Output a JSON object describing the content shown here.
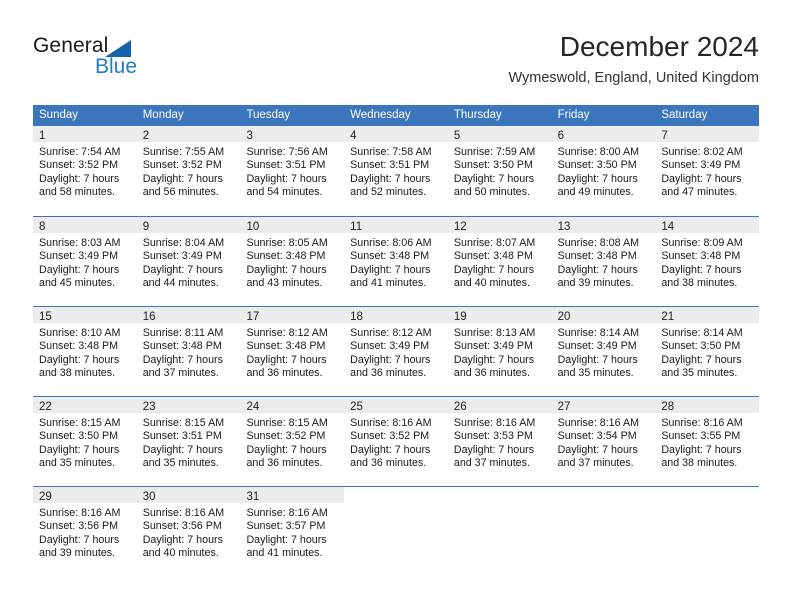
{
  "brand": {
    "name_part1": "General",
    "name_part2": "Blue"
  },
  "header": {
    "title": "December 2024",
    "location": "Wymeswold, England, United Kingdom"
  },
  "colors": {
    "header_blue": "#3b76bd",
    "daynum_band": "#ececec",
    "brand_blue": "#1d7dc4",
    "triangle_blue": "#1663ac"
  },
  "weekdays": [
    "Sunday",
    "Monday",
    "Tuesday",
    "Wednesday",
    "Thursday",
    "Friday",
    "Saturday"
  ],
  "weeks": [
    [
      {
        "day": "1",
        "sunrise": "Sunrise: 7:54 AM",
        "sunset": "Sunset: 3:52 PM",
        "daylight1": "Daylight: 7 hours",
        "daylight2": "and 58 minutes."
      },
      {
        "day": "2",
        "sunrise": "Sunrise: 7:55 AM",
        "sunset": "Sunset: 3:52 PM",
        "daylight1": "Daylight: 7 hours",
        "daylight2": "and 56 minutes."
      },
      {
        "day": "3",
        "sunrise": "Sunrise: 7:56 AM",
        "sunset": "Sunset: 3:51 PM",
        "daylight1": "Daylight: 7 hours",
        "daylight2": "and 54 minutes."
      },
      {
        "day": "4",
        "sunrise": "Sunrise: 7:58 AM",
        "sunset": "Sunset: 3:51 PM",
        "daylight1": "Daylight: 7 hours",
        "daylight2": "and 52 minutes."
      },
      {
        "day": "5",
        "sunrise": "Sunrise: 7:59 AM",
        "sunset": "Sunset: 3:50 PM",
        "daylight1": "Daylight: 7 hours",
        "daylight2": "and 50 minutes."
      },
      {
        "day": "6",
        "sunrise": "Sunrise: 8:00 AM",
        "sunset": "Sunset: 3:50 PM",
        "daylight1": "Daylight: 7 hours",
        "daylight2": "and 49 minutes."
      },
      {
        "day": "7",
        "sunrise": "Sunrise: 8:02 AM",
        "sunset": "Sunset: 3:49 PM",
        "daylight1": "Daylight: 7 hours",
        "daylight2": "and 47 minutes."
      }
    ],
    [
      {
        "day": "8",
        "sunrise": "Sunrise: 8:03 AM",
        "sunset": "Sunset: 3:49 PM",
        "daylight1": "Daylight: 7 hours",
        "daylight2": "and 45 minutes."
      },
      {
        "day": "9",
        "sunrise": "Sunrise: 8:04 AM",
        "sunset": "Sunset: 3:49 PM",
        "daylight1": "Daylight: 7 hours",
        "daylight2": "and 44 minutes."
      },
      {
        "day": "10",
        "sunrise": "Sunrise: 8:05 AM",
        "sunset": "Sunset: 3:48 PM",
        "daylight1": "Daylight: 7 hours",
        "daylight2": "and 43 minutes."
      },
      {
        "day": "11",
        "sunrise": "Sunrise: 8:06 AM",
        "sunset": "Sunset: 3:48 PM",
        "daylight1": "Daylight: 7 hours",
        "daylight2": "and 41 minutes."
      },
      {
        "day": "12",
        "sunrise": "Sunrise: 8:07 AM",
        "sunset": "Sunset: 3:48 PM",
        "daylight1": "Daylight: 7 hours",
        "daylight2": "and 40 minutes."
      },
      {
        "day": "13",
        "sunrise": "Sunrise: 8:08 AM",
        "sunset": "Sunset: 3:48 PM",
        "daylight1": "Daylight: 7 hours",
        "daylight2": "and 39 minutes."
      },
      {
        "day": "14",
        "sunrise": "Sunrise: 8:09 AM",
        "sunset": "Sunset: 3:48 PM",
        "daylight1": "Daylight: 7 hours",
        "daylight2": "and 38 minutes."
      }
    ],
    [
      {
        "day": "15",
        "sunrise": "Sunrise: 8:10 AM",
        "sunset": "Sunset: 3:48 PM",
        "daylight1": "Daylight: 7 hours",
        "daylight2": "and 38 minutes."
      },
      {
        "day": "16",
        "sunrise": "Sunrise: 8:11 AM",
        "sunset": "Sunset: 3:48 PM",
        "daylight1": "Daylight: 7 hours",
        "daylight2": "and 37 minutes."
      },
      {
        "day": "17",
        "sunrise": "Sunrise: 8:12 AM",
        "sunset": "Sunset: 3:48 PM",
        "daylight1": "Daylight: 7 hours",
        "daylight2": "and 36 minutes."
      },
      {
        "day": "18",
        "sunrise": "Sunrise: 8:12 AM",
        "sunset": "Sunset: 3:49 PM",
        "daylight1": "Daylight: 7 hours",
        "daylight2": "and 36 minutes."
      },
      {
        "day": "19",
        "sunrise": "Sunrise: 8:13 AM",
        "sunset": "Sunset: 3:49 PM",
        "daylight1": "Daylight: 7 hours",
        "daylight2": "and 36 minutes."
      },
      {
        "day": "20",
        "sunrise": "Sunrise: 8:14 AM",
        "sunset": "Sunset: 3:49 PM",
        "daylight1": "Daylight: 7 hours",
        "daylight2": "and 35 minutes."
      },
      {
        "day": "21",
        "sunrise": "Sunrise: 8:14 AM",
        "sunset": "Sunset: 3:50 PM",
        "daylight1": "Daylight: 7 hours",
        "daylight2": "and 35 minutes."
      }
    ],
    [
      {
        "day": "22",
        "sunrise": "Sunrise: 8:15 AM",
        "sunset": "Sunset: 3:50 PM",
        "daylight1": "Daylight: 7 hours",
        "daylight2": "and 35 minutes."
      },
      {
        "day": "23",
        "sunrise": "Sunrise: 8:15 AM",
        "sunset": "Sunset: 3:51 PM",
        "daylight1": "Daylight: 7 hours",
        "daylight2": "and 35 minutes."
      },
      {
        "day": "24",
        "sunrise": "Sunrise: 8:15 AM",
        "sunset": "Sunset: 3:52 PM",
        "daylight1": "Daylight: 7 hours",
        "daylight2": "and 36 minutes."
      },
      {
        "day": "25",
        "sunrise": "Sunrise: 8:16 AM",
        "sunset": "Sunset: 3:52 PM",
        "daylight1": "Daylight: 7 hours",
        "daylight2": "and 36 minutes."
      },
      {
        "day": "26",
        "sunrise": "Sunrise: 8:16 AM",
        "sunset": "Sunset: 3:53 PM",
        "daylight1": "Daylight: 7 hours",
        "daylight2": "and 37 minutes."
      },
      {
        "day": "27",
        "sunrise": "Sunrise: 8:16 AM",
        "sunset": "Sunset: 3:54 PM",
        "daylight1": "Daylight: 7 hours",
        "daylight2": "and 37 minutes."
      },
      {
        "day": "28",
        "sunrise": "Sunrise: 8:16 AM",
        "sunset": "Sunset: 3:55 PM",
        "daylight1": "Daylight: 7 hours",
        "daylight2": "and 38 minutes."
      }
    ],
    [
      {
        "day": "29",
        "sunrise": "Sunrise: 8:16 AM",
        "sunset": "Sunset: 3:56 PM",
        "daylight1": "Daylight: 7 hours",
        "daylight2": "and 39 minutes."
      },
      {
        "day": "30",
        "sunrise": "Sunrise: 8:16 AM",
        "sunset": "Sunset: 3:56 PM",
        "daylight1": "Daylight: 7 hours",
        "daylight2": "and 40 minutes."
      },
      {
        "day": "31",
        "sunrise": "Sunrise: 8:16 AM",
        "sunset": "Sunset: 3:57 PM",
        "daylight1": "Daylight: 7 hours",
        "daylight2": "and 41 minutes."
      },
      {
        "day": "",
        "sunrise": "",
        "sunset": "",
        "daylight1": "",
        "daylight2": ""
      },
      {
        "day": "",
        "sunrise": "",
        "sunset": "",
        "daylight1": "",
        "daylight2": ""
      },
      {
        "day": "",
        "sunrise": "",
        "sunset": "",
        "daylight1": "",
        "daylight2": ""
      },
      {
        "day": "",
        "sunrise": "",
        "sunset": "",
        "daylight1": "",
        "daylight2": ""
      }
    ]
  ]
}
